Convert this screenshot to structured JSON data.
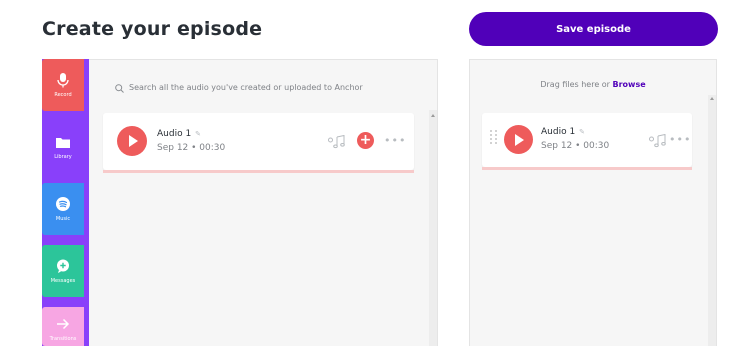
{
  "page": {
    "title": "Create your episode"
  },
  "header": {
    "save_label": "Save episode"
  },
  "sidebar": {
    "items": [
      {
        "label": "Record",
        "icon": "microphone-icon",
        "color": "#ee5b5b"
      },
      {
        "label": "Library",
        "icon": "folder-icon",
        "color": "#8940fa"
      },
      {
        "label": "Music",
        "icon": "spotify-icon",
        "color": "#3a8ff0"
      },
      {
        "label": "Messages",
        "icon": "chat-plus-icon",
        "color": "#2cc59a"
      },
      {
        "label": "Transitions",
        "icon": "arrow-right-icon",
        "color": "#f7a6e3"
      }
    ],
    "accent": "#8940fa"
  },
  "library": {
    "search_placeholder": "Search all the audio you've created or uploaded to Anchor",
    "items": [
      {
        "title": "Audio 1",
        "meta": "Sep 12 • 00:30"
      }
    ]
  },
  "episode": {
    "drop_text": "Drag files here or",
    "browse_label": "Browse",
    "items": [
      {
        "title": "Audio 1",
        "meta": "Sep 12 • 00:30"
      }
    ]
  },
  "colors": {
    "primary": "#5000b9",
    "play": "#ee5b5b"
  }
}
